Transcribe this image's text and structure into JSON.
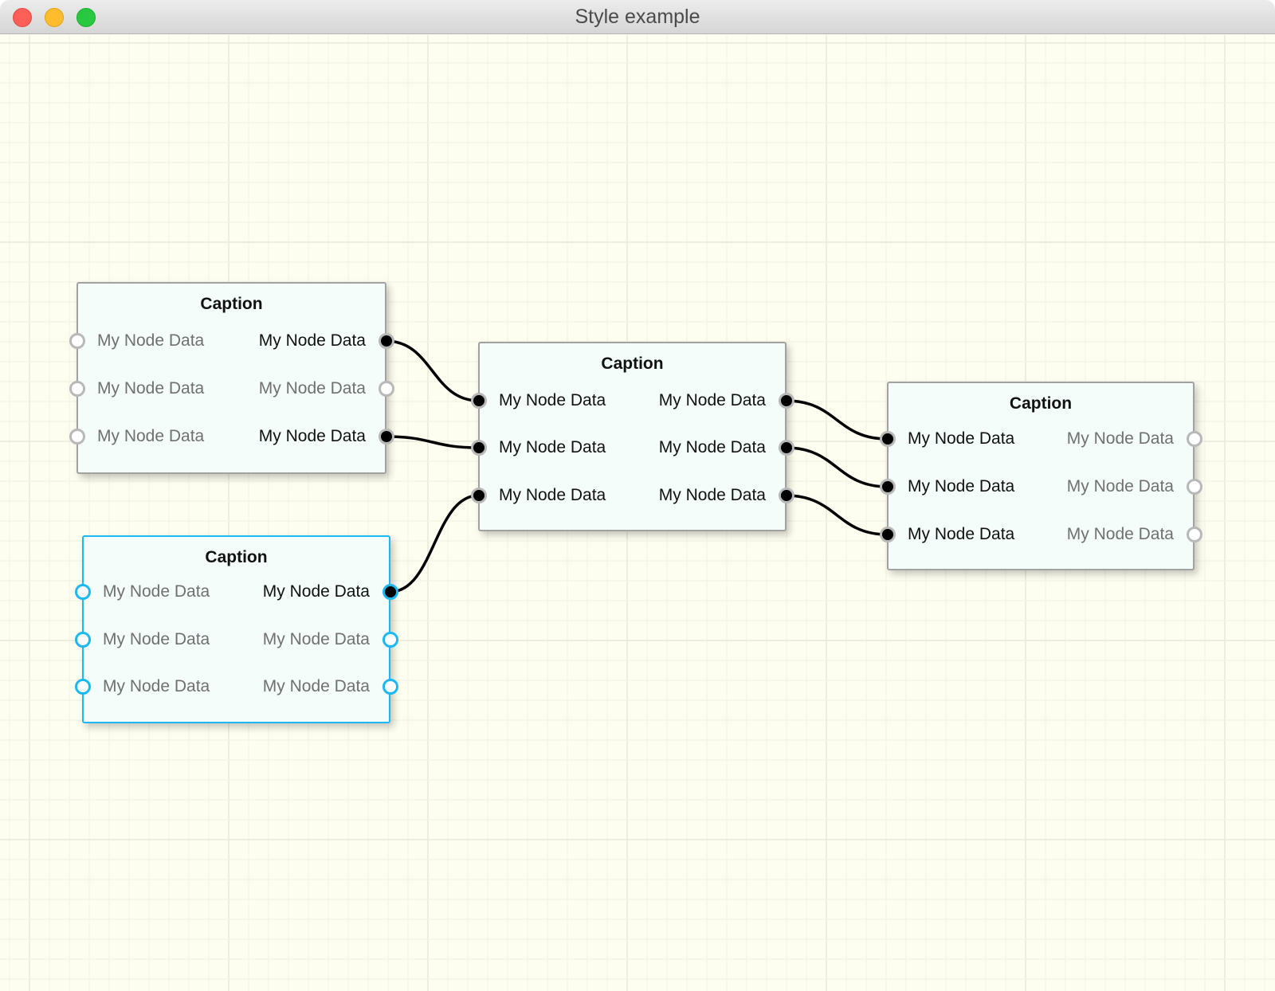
{
  "window": {
    "title": "Style example",
    "buttons": [
      "close",
      "minimize",
      "maximize"
    ]
  },
  "colors": {
    "canvas_background": "#fefef0",
    "grid_minor": "#f3f3e3",
    "grid_major": "#e9e9d9",
    "node_background": "#f4fdf9",
    "node_border": "#a2a2a2",
    "selection": "#1cb8f2",
    "active_text": "#111111",
    "inactive_text": "#707070",
    "wire": "#000000"
  },
  "nodes": [
    {
      "id": "node-a",
      "caption": "Caption",
      "selected": false,
      "rows": [
        {
          "left": {
            "label": "My Node Data",
            "connected": false
          },
          "right": {
            "label": "My Node Data",
            "connected": true
          }
        },
        {
          "left": {
            "label": "My Node Data",
            "connected": false
          },
          "right": {
            "label": "My Node Data",
            "connected": false
          }
        },
        {
          "left": {
            "label": "My Node Data",
            "connected": false
          },
          "right": {
            "label": "My Node Data",
            "connected": true
          }
        }
      ]
    },
    {
      "id": "node-b",
      "caption": "Caption",
      "selected": false,
      "rows": [
        {
          "left": {
            "label": "My Node Data",
            "connected": true
          },
          "right": {
            "label": "My Node Data",
            "connected": true
          }
        },
        {
          "left": {
            "label": "My Node Data",
            "connected": true
          },
          "right": {
            "label": "My Node Data",
            "connected": true
          }
        },
        {
          "left": {
            "label": "My Node Data",
            "connected": true
          },
          "right": {
            "label": "My Node Data",
            "connected": true
          }
        }
      ]
    },
    {
      "id": "node-c",
      "caption": "Caption",
      "selected": false,
      "rows": [
        {
          "left": {
            "label": "My Node Data",
            "connected": true
          },
          "right": {
            "label": "My Node Data",
            "connected": false
          }
        },
        {
          "left": {
            "label": "My Node Data",
            "connected": true
          },
          "right": {
            "label": "My Node Data",
            "connected": false
          }
        },
        {
          "left": {
            "label": "My Node Data",
            "connected": true
          },
          "right": {
            "label": "My Node Data",
            "connected": false
          }
        }
      ]
    },
    {
      "id": "node-d",
      "caption": "Caption",
      "selected": true,
      "rows": [
        {
          "left": {
            "label": "My Node Data",
            "connected": false
          },
          "right": {
            "label": "My Node Data",
            "connected": true
          }
        },
        {
          "left": {
            "label": "My Node Data",
            "connected": false
          },
          "right": {
            "label": "My Node Data",
            "connected": false
          }
        },
        {
          "left": {
            "label": "My Node Data",
            "connected": false
          },
          "right": {
            "label": "My Node Data",
            "connected": false
          }
        }
      ]
    }
  ],
  "connections": [
    {
      "from": {
        "node": 0,
        "row": 0
      },
      "to": {
        "node": 1,
        "row": 0
      }
    },
    {
      "from": {
        "node": 0,
        "row": 2
      },
      "to": {
        "node": 1,
        "row": 1
      }
    },
    {
      "from": {
        "node": 3,
        "row": 0
      },
      "to": {
        "node": 1,
        "row": 2
      }
    },
    {
      "from": {
        "node": 1,
        "row": 0
      },
      "to": {
        "node": 2,
        "row": 0
      }
    },
    {
      "from": {
        "node": 1,
        "row": 1
      },
      "to": {
        "node": 2,
        "row": 1
      }
    },
    {
      "from": {
        "node": 1,
        "row": 2
      },
      "to": {
        "node": 2,
        "row": 2
      }
    }
  ]
}
